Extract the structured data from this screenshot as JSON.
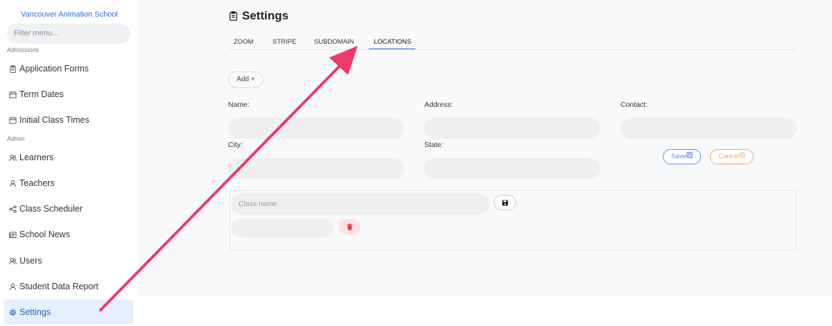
{
  "sidebar": {
    "school_name": "Vancouver Animation School",
    "filter_placeholder": "Filter menu...",
    "sections": {
      "admissions": "Admissions",
      "admin": "Admin"
    },
    "items": [
      {
        "label": "Application Forms",
        "icon": "clipboard-icon"
      },
      {
        "label": "Term Dates",
        "icon": "calendar-icon"
      },
      {
        "label": "Initial Class Times",
        "icon": "calendar-icon"
      },
      {
        "label": "Learners",
        "icon": "users-icon"
      },
      {
        "label": "Teachers",
        "icon": "user-icon"
      },
      {
        "label": "Class Scheduler",
        "icon": "share-icon"
      },
      {
        "label": "School News",
        "icon": "newspaper-icon"
      },
      {
        "label": "Users",
        "icon": "users-icon"
      },
      {
        "label": "Student Data Report",
        "icon": "user-icon"
      },
      {
        "label": "Settings",
        "icon": "gear-icon",
        "active": true
      }
    ]
  },
  "main": {
    "title": "Settings",
    "tabs": [
      {
        "label": "ZOOM"
      },
      {
        "label": "STRIPE"
      },
      {
        "label": "SUBDOMAIN"
      },
      {
        "label": "LOCATIONS",
        "active": true
      }
    ],
    "add_label": "Add +",
    "form": {
      "name_label": "Name:",
      "address_label": "Address:",
      "contact_label": "Contact:",
      "city_label": "City:",
      "state_label": "State:",
      "name_value": "",
      "address_value": "",
      "contact_value": "",
      "city_value": "",
      "state_value": ""
    },
    "save_label": "Save",
    "cancel_label": "Cancel",
    "class_name_placeholder": "Class name"
  },
  "colors": {
    "accent": "#2b6cd8",
    "active_bg": "#e6efff",
    "save": "#5b8de6",
    "cancel": "#f0a85a",
    "delete": "#e53935",
    "annotation_arrow": "#f0386b"
  }
}
